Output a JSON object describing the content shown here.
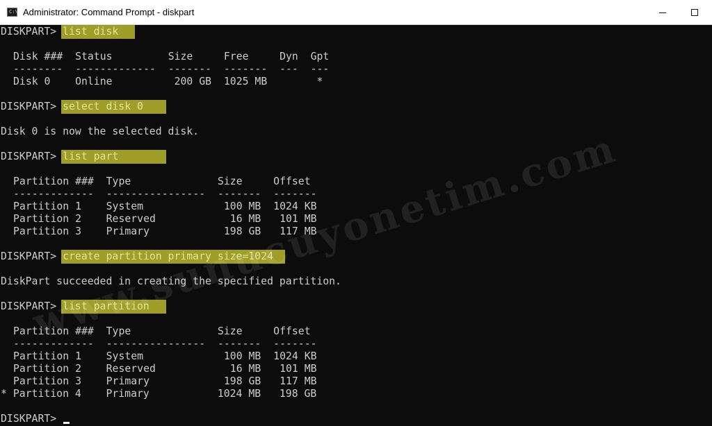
{
  "window": {
    "title": "Administrator: Command Prompt - diskpart",
    "icon": "cmd-icon",
    "icon_glyph": "C:\\."
  },
  "console": {
    "prompt": "DISKPART>",
    "commands": [
      "list disk",
      "select disk 0",
      "list part",
      "create partition primary size=1024",
      "list partition"
    ],
    "lines": [
      "Disk ###  Status         Size     Free     Dyn  Gpt",
      "--------  -------------  -------  -------  ---  ---",
      "Disk 0    Online          200 GB  1025 MB        *",
      "Disk 0 is now the selected disk.",
      "Partition ###  Type              Size     Offset",
      "-------------  ----------------  -------  -------",
      "Partition 1    System             100 MB  1024 KB",
      "Partition 2    Reserved            16 MB   101 MB",
      "Partition 3    Primary            198 GB   117 MB",
      "DiskPart succeeded in creating the specified partition.",
      "Partition ###  Type              Size     Offset",
      "-------------  ----------------  -------  -------",
      "Partition 1    System             100 MB  1024 KB",
      "Partition 2    Reserved            16 MB   101 MB",
      "Partition 3    Primary            198 GB   117 MB",
      "* Partition 4    Primary           1024 MB   198 GB"
    ]
  },
  "watermark": "www.sunucuyonetim.com",
  "colors": {
    "console_bg": "#0c0c0c",
    "console_text": "#cccccc",
    "highlight": "#a7a62a"
  }
}
